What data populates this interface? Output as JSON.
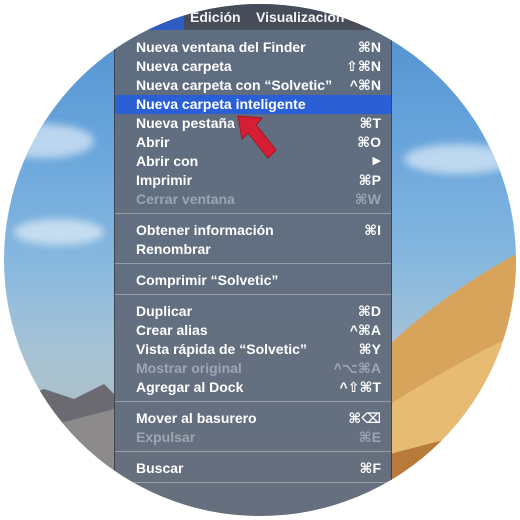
{
  "menubar": {
    "items": [
      "Edición",
      "Visualización"
    ],
    "active_index": 0
  },
  "menu": {
    "items": [
      {
        "label": "Nueva ventana del Finder",
        "shortcut": "⌘N",
        "enabled": true
      },
      {
        "label": "Nueva carpeta",
        "shortcut": "⇧⌘N",
        "enabled": true
      },
      {
        "label": "Nueva carpeta con “Solvetic”",
        "shortcut": "^⌘N",
        "enabled": true
      },
      {
        "label": "Nueva carpeta inteligente",
        "shortcut": "",
        "enabled": true,
        "selected": true
      },
      {
        "label": "Nueva pestaña",
        "shortcut": "⌘T",
        "enabled": true
      },
      {
        "label": "Abrir",
        "shortcut": "⌘O",
        "enabled": true
      },
      {
        "label": "Abrir con",
        "shortcut": "▶",
        "enabled": true
      },
      {
        "label": "Imprimir",
        "shortcut": "⌘P",
        "enabled": true
      },
      {
        "label": "Cerrar ventana",
        "shortcut": "⌘W",
        "enabled": false
      },
      {
        "label": "Obtener información",
        "shortcut": "⌘I",
        "enabled": true
      },
      {
        "label": "Renombrar",
        "shortcut": "",
        "enabled": true
      },
      {
        "label": "Comprimir “Solvetic”",
        "shortcut": "",
        "enabled": true
      },
      {
        "label": "Duplicar",
        "shortcut": "⌘D",
        "enabled": true
      },
      {
        "label": "Crear alias",
        "shortcut": "^⌘A",
        "enabled": true
      },
      {
        "label": "Vista rápida de “Solvetic”",
        "shortcut": "⌘Y",
        "enabled": true
      },
      {
        "label": "Mostrar original",
        "shortcut": "^⌥⌘A",
        "enabled": false
      },
      {
        "label": "Agregar al Dock",
        "shortcut": "^⇧⌘T",
        "enabled": true
      },
      {
        "label": "Mover al basurero",
        "shortcut": "⌘⌫",
        "enabled": true
      },
      {
        "label": "Expulsar",
        "shortcut": "⌘E",
        "enabled": false
      },
      {
        "label": "Buscar",
        "shortcut": "⌘F",
        "enabled": true
      }
    ]
  },
  "tags": {
    "colors": [
      "#f5a623",
      "#f8e71c",
      "#4cd964",
      "#2e8ff5",
      "#d65be8",
      "#a8a8ae"
    ],
    "names": [
      "orange-tag",
      "yellow-tag",
      "green-tag",
      "blue-tag",
      "purple-tag",
      "gray-tag"
    ]
  },
  "annotation": {
    "arrow_color": "#d81e34",
    "icon": "red-arrow-icon"
  }
}
